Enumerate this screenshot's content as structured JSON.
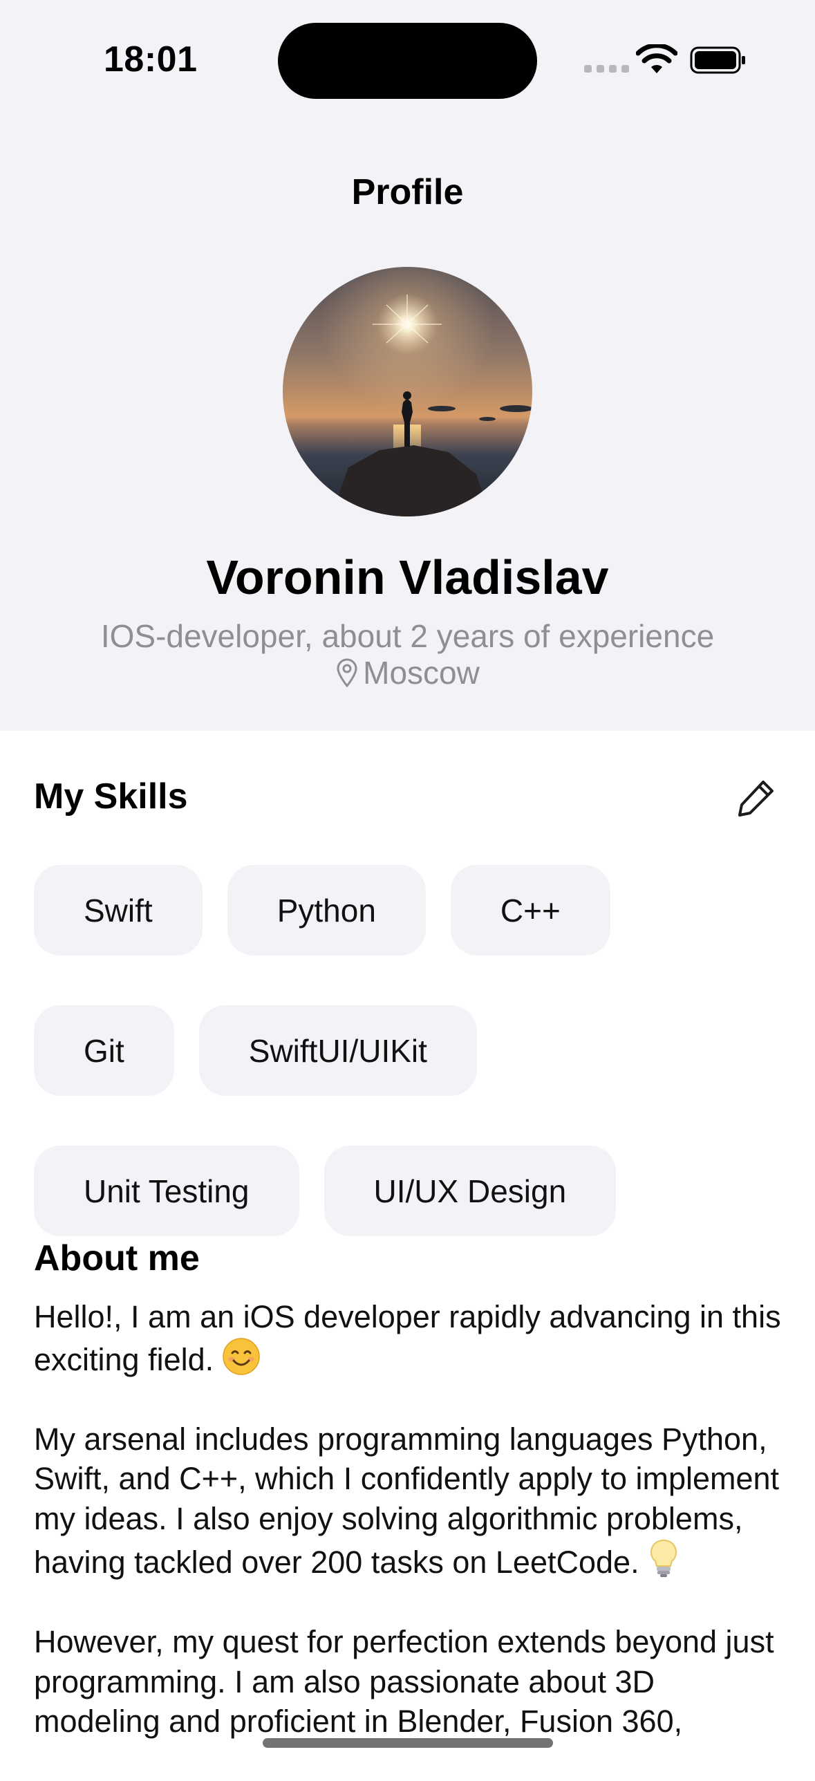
{
  "status_bar": {
    "time": "18:01",
    "icons": [
      "cellular-signal-icon",
      "wifi-icon",
      "battery-icon"
    ]
  },
  "nav": {
    "title": "Profile"
  },
  "profile": {
    "avatar_icon": "avatar-photo",
    "name": "Voronin Vladislav",
    "subtitle": "IOS-developer, about 2 years of experience",
    "location_icon": "map-pin-icon",
    "location": "Moscow"
  },
  "skills": {
    "title": "My Skills",
    "edit_icon": "pencil-icon",
    "rows": [
      [
        "Swift",
        "Python",
        "C++"
      ],
      [
        "Git",
        "SwiftUI/UIKit"
      ],
      [
        "Unit Testing",
        "UI/UX Design"
      ]
    ]
  },
  "about": {
    "title": "About me",
    "paragraphs": [
      {
        "text": "Hello!, I am an iOS developer rapidly advancing in this exciting field.",
        "emoji": "smiling-face-emoji"
      },
      {
        "text": "My arsenal includes programming languages Python, Swift, and C++, which I confidently apply to implement my ideas. I also enjoy solving algorithmic problems, having tackled over 200 tasks on LeetCode.",
        "emoji": "light-bulb-emoji"
      },
      {
        "text": "However, my quest for perfection extends beyond just programming. I am also passionate about 3D modeling and proficient in Blender, Fusion 360,",
        "emoji": null
      }
    ]
  },
  "colors": {
    "header_background": "#f2f2f7",
    "chip_background": "#f2f2f7",
    "secondary_text": "#8e8e93"
  }
}
